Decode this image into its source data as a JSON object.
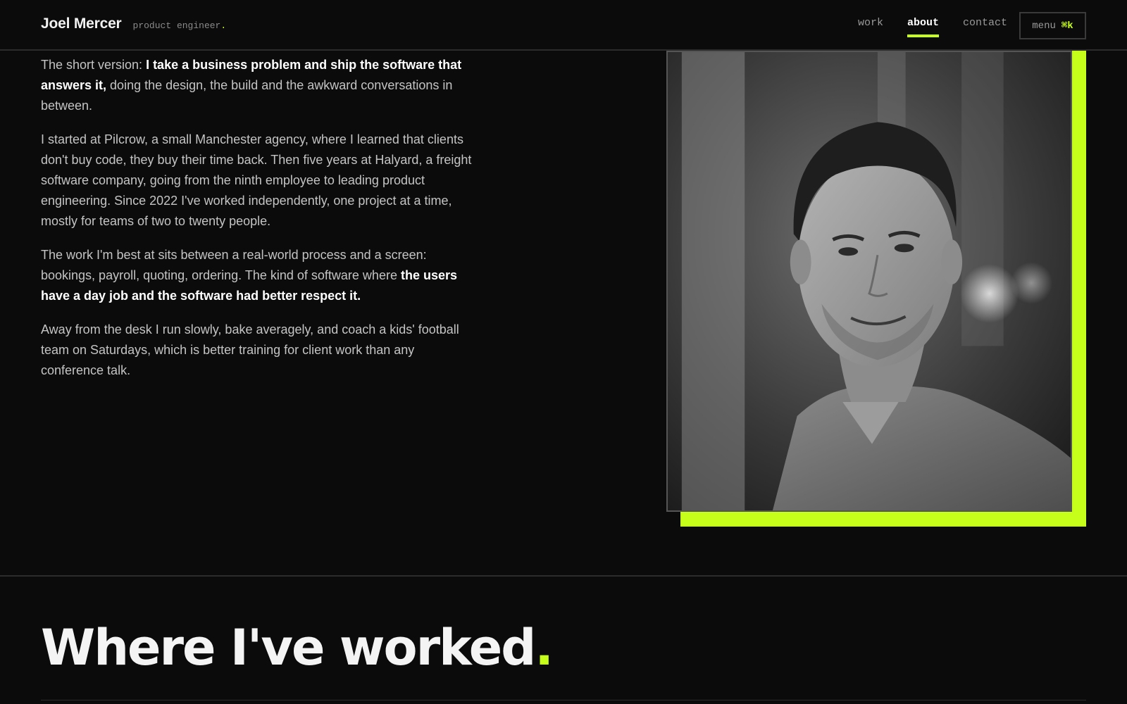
{
  "header": {
    "brand_name": "Joel Mercer",
    "brand_role": "product engineer",
    "brand_role_dot": ".",
    "nav": [
      {
        "label": "work",
        "active": false
      },
      {
        "label": "about",
        "active": true
      },
      {
        "label": "contact",
        "active": false
      }
    ],
    "menu_label": "menu",
    "menu_shortcut": "⌘k"
  },
  "about": {
    "p1": {
      "lead": "The short version: ",
      "bold": "I take a business problem and ship the software that answers it,",
      "rest": " doing the design, the build and the awkward conversations in between."
    },
    "p2": "I started at Pilcrow, a small Manchester agency, where I learned that clients don't buy code, they buy their time back. Then five years at Halyard, a freight software company, going from the ninth employee to leading product engineering. Since 2022 I've worked independently, one project at a time, mostly for teams of two to twenty people.",
    "p3": {
      "lead": "The work I'm best at sits between a real-world process and a screen: bookings, payroll, quoting, ordering. The kind of software where ",
      "bold": "the users have a day job and the software had better respect it."
    },
    "p4": "Away from the desk I run slowly, bake averagely, and coach a kids' football team on Saturdays, which is better training for client work than any conference talk."
  },
  "section": {
    "title": "Where I've worked",
    "title_dot": "."
  },
  "colors": {
    "accent": "#c6ff1a",
    "background": "#0b0b0b",
    "text": "#c4c4c4"
  }
}
